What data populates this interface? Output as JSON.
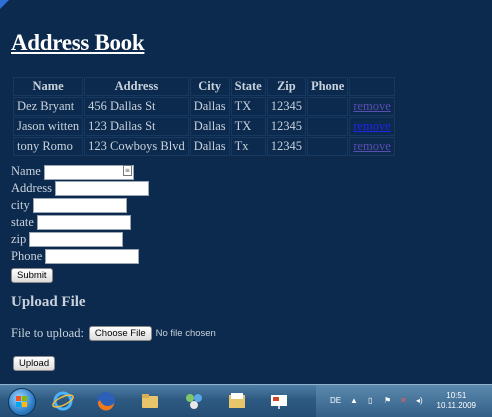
{
  "page": {
    "title": "Address Book"
  },
  "contacts": {
    "headers": [
      "Name",
      "Address",
      "City",
      "State",
      "Zip",
      "Phone"
    ],
    "remove_label": "remove",
    "rows": [
      {
        "name": "Dez Bryant",
        "address": "456 Dallas St",
        "city": "Dallas",
        "state": "TX",
        "zip": "12345",
        "phone": ""
      },
      {
        "name": "Jason witten",
        "address": "123 Dallas St",
        "city": "Dallas",
        "state": "TX",
        "zip": "12345",
        "phone": ""
      },
      {
        "name": "tony Romo",
        "address": "123 Cowboys Blvd",
        "city": "Dallas",
        "state": "Tx",
        "zip": "12345",
        "phone": ""
      }
    ]
  },
  "form": {
    "name_label": "Name",
    "address_label": "Address",
    "city_label": "city",
    "state_label": "state",
    "zip_label": "zip",
    "phone_label": "Phone",
    "submit_label": "Submit"
  },
  "upload": {
    "heading": "Upload File",
    "file_label": "File to upload:",
    "choose_label": "Choose File",
    "no_file_text": "No file chosen",
    "upload_label": "Upload"
  },
  "taskbar": {
    "icons": [
      "start-orb",
      "internet-explorer-icon",
      "firefox-icon",
      "explorer-folder-icon",
      "network-icon",
      "documents-icon",
      "presentation-icon"
    ],
    "language": "DE",
    "time": "10:51",
    "date": "10.11.2009"
  }
}
